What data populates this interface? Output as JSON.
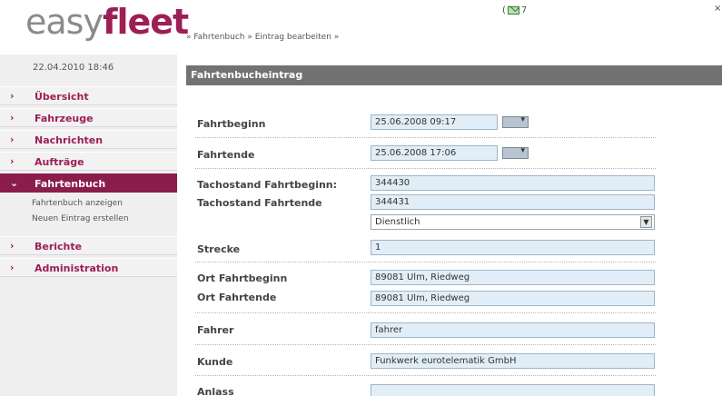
{
  "logo": {
    "part1": "easy",
    "part2": "fleet"
  },
  "breadcrumb": "» Fahrtenbuch » Eintrag bearbeiten »",
  "mail": {
    "count": "7",
    "icon": "envelope-icon"
  },
  "corner_mark": "×",
  "sidebar": {
    "datetime": "22.04.2010 18:46",
    "items": [
      {
        "label": "Übersicht",
        "icon": "chevron-right-icon"
      },
      {
        "label": "Fahrzeuge",
        "icon": "chevron-right-icon"
      },
      {
        "label": "Nachrichten",
        "icon": "chevron-right-icon"
      },
      {
        "label": "Aufträge",
        "icon": "chevron-right-icon"
      },
      {
        "label": "Fahrtenbuch",
        "icon": "chevron-down-icon",
        "active": true
      },
      {
        "label": "Berichte",
        "icon": "chevron-right-icon"
      },
      {
        "label": "Administration",
        "icon": "chevron-right-icon"
      }
    ],
    "subitems": [
      {
        "label": "Fahrtenbuch anzeigen"
      },
      {
        "label": "Neuen Eintrag erstellen"
      }
    ]
  },
  "main": {
    "title": "Fahrtenbucheintrag",
    "fields": {
      "fahrtbeginn": {
        "label": "Fahrtbeginn",
        "value": "25.06.2008 09:17"
      },
      "fahrtende": {
        "label": "Fahrtende",
        "value": "25.06.2008 17:06"
      },
      "tacho_beginn": {
        "label": "Tachostand Fahrtbeginn:",
        "value": "344430"
      },
      "tacho_ende": {
        "label": "Tachostand Fahrtende",
        "value": "344431"
      },
      "fahrttyp": {
        "value": "Dienstlich"
      },
      "strecke": {
        "label": "Strecke",
        "value": "1"
      },
      "ort_beginn": {
        "label": "Ort Fahrtbeginn",
        "value": "89081 Ulm, Riedweg"
      },
      "ort_ende": {
        "label": "Ort Fahrtende",
        "value": "89081 Ulm, Riedweg"
      },
      "fahrer": {
        "label": "Fahrer",
        "value": "fahrer"
      },
      "kunde": {
        "label": "Kunde",
        "value": "Funkwerk eurotelematik GmbH"
      },
      "anlass": {
        "label": "Anlass",
        "value": ""
      }
    }
  },
  "colors": {
    "brand": "#9c1f55",
    "active_nav": "#8b1d4c",
    "header_bar": "#727272",
    "input_bg": "#e2eef7"
  }
}
